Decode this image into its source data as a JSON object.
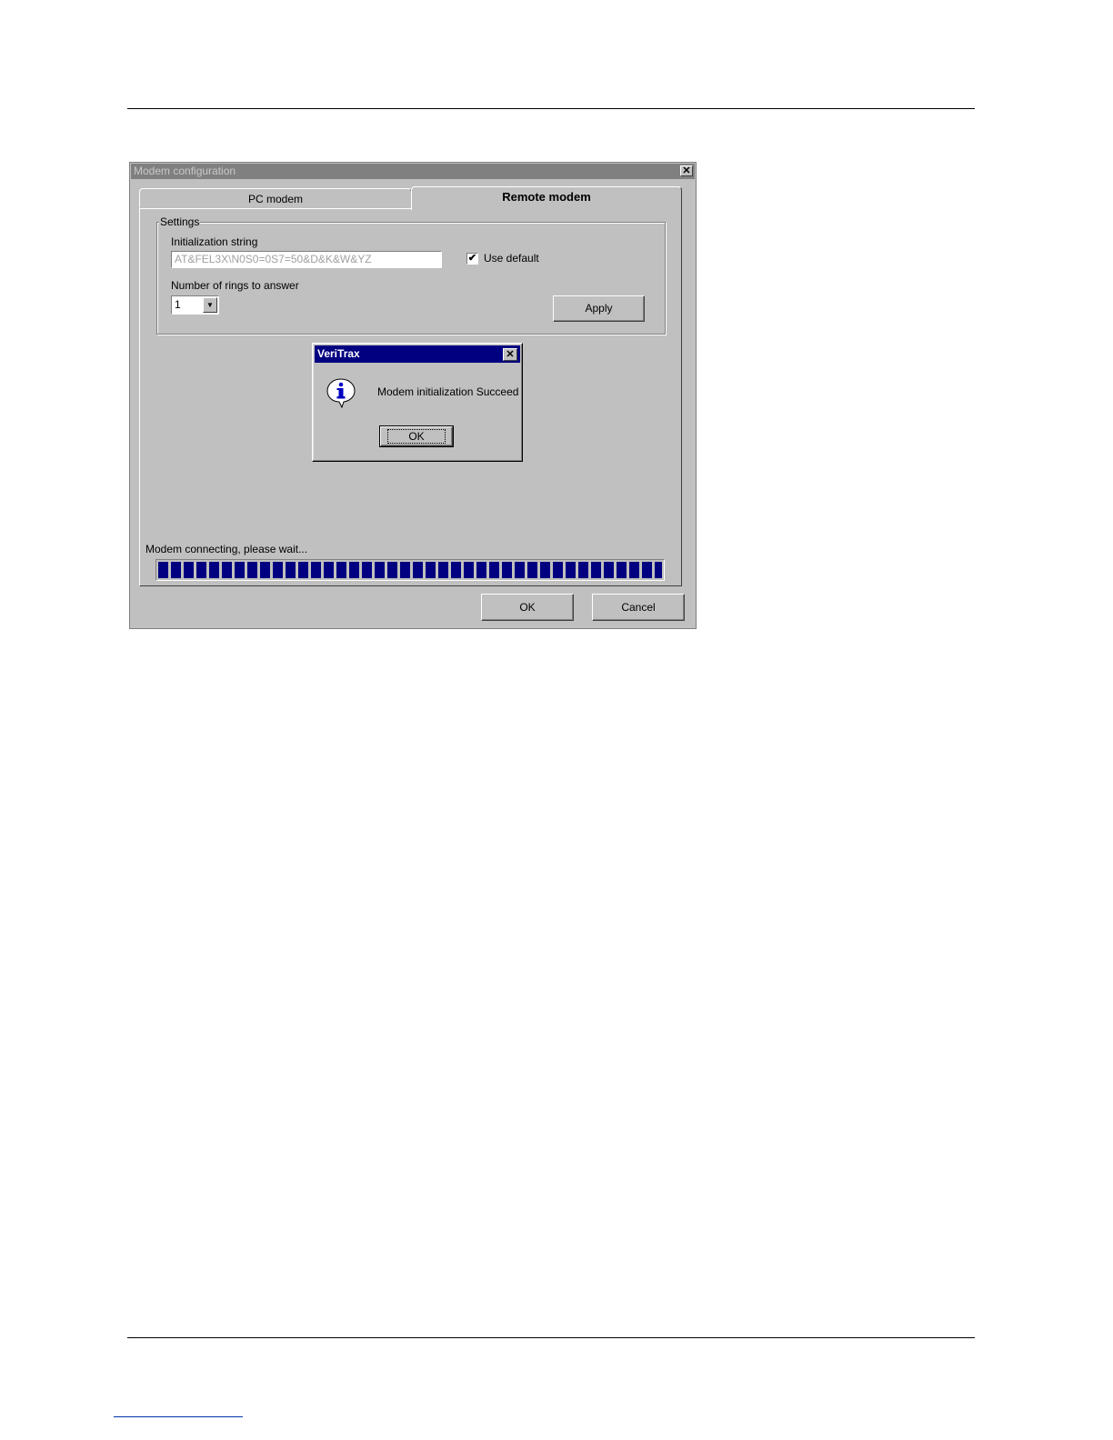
{
  "window": {
    "title": "Modem configuration",
    "close_glyph": "✕"
  },
  "tabs": [
    {
      "label": "PC modem",
      "selected": false
    },
    {
      "label": "Remote modem",
      "selected": true
    }
  ],
  "settings": {
    "group_title": "Settings",
    "init_label": "Initialization string",
    "init_value": "AT&FEL3X\\N0S0=0S7=50&D&K&W&YZ",
    "use_default_label": "Use default",
    "use_default_checked": true,
    "check_glyph": "✔",
    "rings_label": "Number of rings to answer",
    "rings_value": "1",
    "apply_label": "Apply"
  },
  "status": {
    "text": "Modem connecting, please wait...",
    "progress_fraction": 1.0
  },
  "footer": {
    "ok_label": "OK",
    "cancel_label": "Cancel"
  },
  "message_box": {
    "title": "VeriTrax",
    "message": "Modem initialization Succeed",
    "ok_label": "OK",
    "icon": "info-icon",
    "close_glyph": "✕"
  },
  "colors": {
    "titlebar_active": "#000080",
    "titlebar_inactive": "#808080",
    "face": "#c0c0c0",
    "progress": "#000080"
  }
}
